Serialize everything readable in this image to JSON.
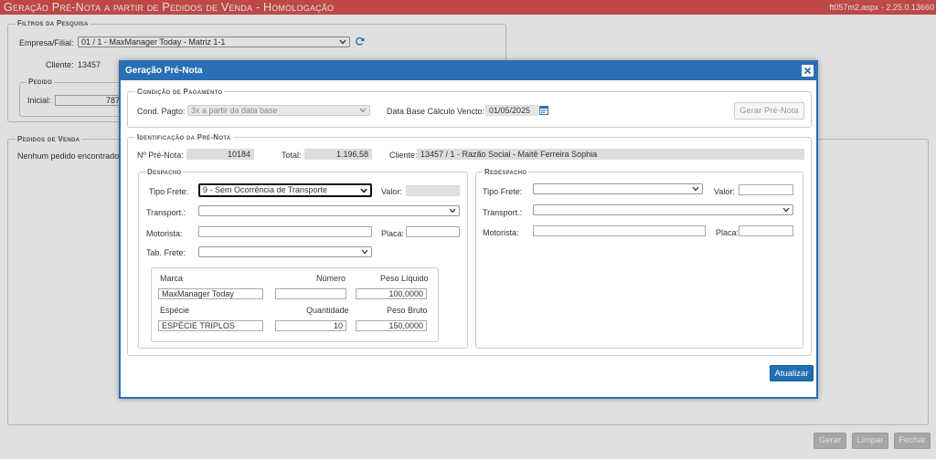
{
  "page": {
    "title": "Geração Pré-Nota a partir de Pedidos de Venda  - Homologação",
    "version": "ft057m2.aspx - 2.25.0.13660"
  },
  "background": {
    "filtros_legend": "Filtros da Pesquisa",
    "empresa_label": "Empresa/Filial:",
    "empresa_value": "01 / 1 - MaxManager Today - Matriz 1-1",
    "cliente_label": "Cliente:",
    "cliente_value": "13457",
    "pedido_legend": "Pedido",
    "inicial_label": "Inicial:",
    "inicial_value": "7871",
    "pedidos_legend": "Pedidos de Venda",
    "nenhum": "Nenhum pedido encontrado"
  },
  "footer": {
    "gerar": "Gerar",
    "limpar": "Limpar",
    "fechar": "Fechar"
  },
  "dialog": {
    "title": "Geração Pré-Nota",
    "condicao_legend": "Condição de Pagamento",
    "cond_label": "Cond. Pagto:",
    "cond_value": "3x a partir da data base",
    "data_base_label": "Data Base Cálculo Vencto:",
    "data_base_value": "01/05/2025",
    "gerar_prenota": "Gerar Pré-Nota",
    "ident_legend": "Identificação da Pré-Nota",
    "nro_label": "Nº Pré-Nota:",
    "nro_value": "10184",
    "total_label": "Total:",
    "total_value": "1.196,58",
    "cliente_label": "Cliente:",
    "cliente_value": "13457 / 1 - Razão Social - Maitê Ferreira Sophia",
    "despacho": {
      "legend": "Despacho",
      "tipo_frete_label": "Tipo Frete:",
      "tipo_frete_value": "9 - Sem Ocorrência de Transporte",
      "valor_label": "Valor:",
      "transport_label": "Transport.:",
      "motorista_label": "Motorista:",
      "placa_label": "Placa:",
      "tab_frete_label": "Tab. Frete:",
      "marca_label": "Marca",
      "numero_label": "Número",
      "peso_liquido_label": "Peso Líquido",
      "marca_value": "MaxManager Today",
      "numero_value": "",
      "peso_liquido_value": "100,0000",
      "especie_label": "Espécie",
      "quantidade_label": "Quantidade",
      "peso_bruto_label": "Peso Bruto",
      "especie_value": "ESPÉCIE TRIPLOS",
      "quantidade_value": "10",
      "peso_bruto_value": "150,0000"
    },
    "redespacho": {
      "legend": "Redespacho",
      "tipo_frete_label": "Tipo Frete:",
      "valor_label": "Valor:",
      "transport_label": "Transport.:",
      "motorista_label": "Motorista:",
      "placa_label": "Placa:"
    },
    "atualizar": "Atualizar"
  }
}
